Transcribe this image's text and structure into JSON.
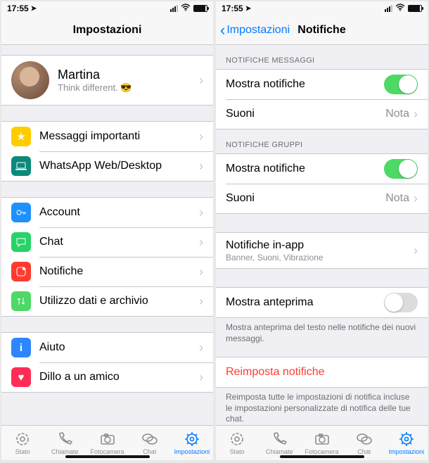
{
  "status": {
    "time": "17:55"
  },
  "left": {
    "title": "Impostazioni",
    "profile": {
      "name": "Martina",
      "status": "Think different.  😎"
    },
    "group1": {
      "starred": {
        "label": "Messaggi importanti",
        "iconColor": "#ffcc00"
      },
      "web": {
        "label": "WhatsApp Web/Desktop",
        "iconColor": "#0b897b"
      }
    },
    "group2": {
      "account": {
        "label": "Account",
        "iconColor": "#1e90ff"
      },
      "chat": {
        "label": "Chat",
        "iconColor": "#25d366"
      },
      "notif": {
        "label": "Notifiche",
        "iconColor": "#ff3b30"
      },
      "data": {
        "label": "Utilizzo dati e archivio",
        "iconColor": "#4cd964"
      }
    },
    "group3": {
      "help": {
        "label": "Aiuto",
        "iconColor": "#2e86ff"
      },
      "friend": {
        "label": "Dillo a un amico",
        "iconColor": "#ff2d55"
      }
    },
    "tabs": {
      "status": "Stato",
      "calls": "Chiamate",
      "camera": "Fotocamera",
      "chats": "Chat",
      "settings": "Impostazioni"
    }
  },
  "right": {
    "back": "Impostazioni",
    "title": "Notifiche",
    "sectionMsgs": "NOTIFICHE MESSAGGI",
    "msgs": {
      "show": {
        "label": "Mostra notifiche",
        "on": true
      },
      "sound": {
        "label": "Suoni",
        "value": "Nota"
      }
    },
    "sectionGroups": "NOTIFICHE GRUPPI",
    "groups": {
      "show": {
        "label": "Mostra notifiche",
        "on": true
      },
      "sound": {
        "label": "Suoni",
        "value": "Nota"
      }
    },
    "inapp": {
      "label": "Notifiche in-app",
      "sub": "Banner, Suoni, Vibrazione"
    },
    "preview": {
      "label": "Mostra anteprima",
      "on": false
    },
    "previewFooter": "Mostra anteprima del testo nelle notifiche dei nuovi messaggi.",
    "reset": {
      "label": "Reimposta notifiche"
    },
    "resetFooter": "Reimposta tutte le impostazioni di notifica incluse le impostazioni personalizzate di notifica delle tue chat."
  }
}
